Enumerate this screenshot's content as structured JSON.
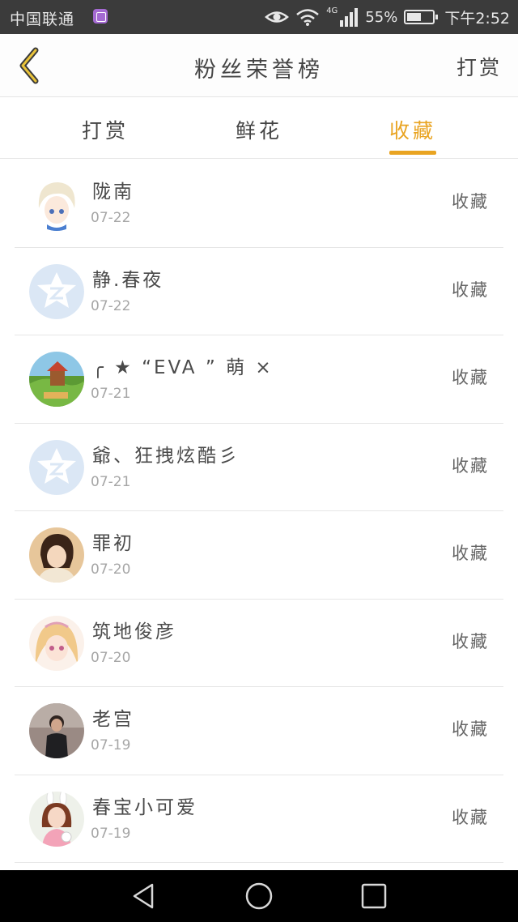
{
  "status_bar": {
    "carrier": "中国联通",
    "network": "4G",
    "battery_text": "55%",
    "battery_level": 0.55,
    "time": "下午2:52"
  },
  "header": {
    "title": "粉丝荣誉榜",
    "action_label": "打赏"
  },
  "tabs": [
    {
      "label": "打赏",
      "active": false
    },
    {
      "label": "鲜花",
      "active": false
    },
    {
      "label": "收藏",
      "active": true
    }
  ],
  "accent_color": "#e9a422",
  "list": [
    {
      "name": "陇南",
      "date": "07-22",
      "action": "收藏",
      "avatar": "anime-boy-avatar"
    },
    {
      "name": "静.春夜",
      "date": "07-22",
      "action": "收藏",
      "avatar": "default-qq-avatar"
    },
    {
      "name": "╭ ★ “EVA ” 萌 ×",
      "date": "07-21",
      "action": "收藏",
      "avatar": "landscape-avatar"
    },
    {
      "name": "爺、狂拽炫酷彡",
      "date": "07-21",
      "action": "收藏",
      "avatar": "default-qq-avatar"
    },
    {
      "name": "罪初",
      "date": "07-20",
      "action": "收藏",
      "avatar": "girl-photo-avatar"
    },
    {
      "name": "筑地俊彦",
      "date": "07-20",
      "action": "收藏",
      "avatar": "anime-girl-avatar"
    },
    {
      "name": "老宫",
      "date": "07-19",
      "action": "收藏",
      "avatar": "man-photo-avatar"
    },
    {
      "name": "春宝小可爱",
      "date": "07-19",
      "action": "收藏",
      "avatar": "girl-bunny-avatar"
    }
  ]
}
